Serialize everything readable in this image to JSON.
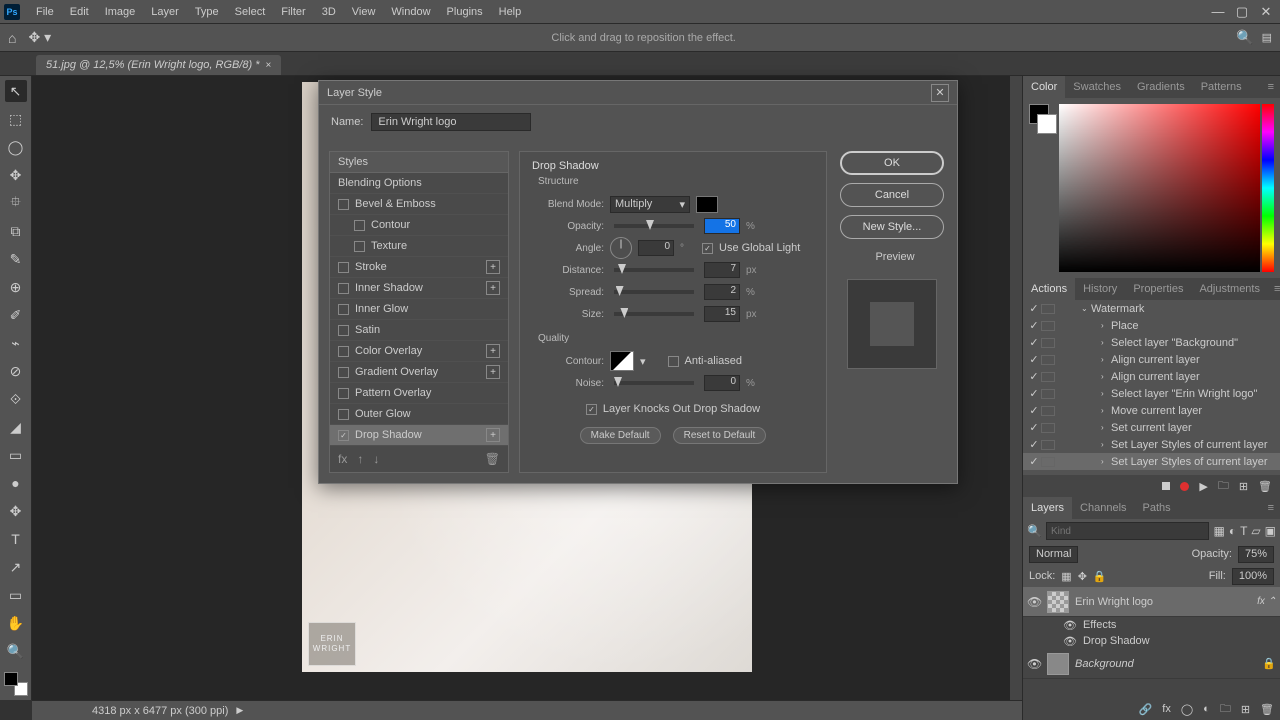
{
  "menu": [
    "File",
    "Edit",
    "Image",
    "Layer",
    "Type",
    "Select",
    "Filter",
    "3D",
    "View",
    "Window",
    "Plugins",
    "Help"
  ],
  "optbar_hint": "Click and drag to reposition the effect.",
  "doc_tab": "51.jpg @ 12,5% (Erin Wright logo, RGB/8) *",
  "status": "4318 px x 6477 px (300 ppi)",
  "logo_text": "ERIN\nWRIGHT",
  "tools": [
    "↖",
    "⬚",
    "◯",
    "✥",
    "⯐",
    "⧉",
    "✎",
    "⊕",
    "✐",
    "⌁",
    "⊘",
    "⟐",
    "◢",
    "▭",
    "●",
    "✥",
    "◔",
    "✏",
    "T",
    "↗",
    "▭",
    "✋",
    "🔍"
  ],
  "color_tabs": [
    "Color",
    "Swatches",
    "Gradients",
    "Patterns"
  ],
  "mid_tabs": [
    "Actions",
    "History",
    "Properties",
    "Adjustments"
  ],
  "actions": [
    {
      "label": "Watermark",
      "indent": 20,
      "chev": "⌄"
    },
    {
      "label": "Place",
      "indent": 40,
      "chev": "›"
    },
    {
      "label": "Select layer \"Background\"",
      "indent": 40,
      "chev": "›"
    },
    {
      "label": "Align current layer",
      "indent": 40,
      "chev": "›"
    },
    {
      "label": "Align current layer",
      "indent": 40,
      "chev": "›"
    },
    {
      "label": "Select layer \"Erin Wright logo\"",
      "indent": 40,
      "chev": "›"
    },
    {
      "label": "Move current layer",
      "indent": 40,
      "chev": "›"
    },
    {
      "label": "Set current layer",
      "indent": 40,
      "chev": "›"
    },
    {
      "label": "Set Layer Styles of current layer",
      "indent": 40,
      "chev": "›"
    },
    {
      "label": "Set Layer Styles of current layer",
      "indent": 40,
      "chev": "›",
      "hi": true
    }
  ],
  "layer_tabs": [
    "Layers",
    "Channels",
    "Paths"
  ],
  "layers_kind": "Kind",
  "layers_mode": "Normal",
  "layers_opacity_label": "Opacity:",
  "layers_opacity": "75%",
  "layers_lock": "Lock:",
  "layers_fill_label": "Fill:",
  "layers_fill": "100%",
  "layer_items": [
    {
      "name": "Erin Wright logo",
      "fx": true,
      "sel": true,
      "check": true
    },
    {
      "name": "Background",
      "fx": false,
      "sel": false,
      "check": false
    }
  ],
  "layer_fx_sub": [
    "Effects",
    "Drop Shadow"
  ],
  "dialog": {
    "title": "Layer Style",
    "name_label": "Name:",
    "name_value": "Erin Wright logo",
    "styles_head": "Styles",
    "blending": "Blending Options",
    "fx": [
      {
        "label": "Bevel & Emboss",
        "on": false,
        "plus": false
      },
      {
        "label": "Contour",
        "on": false,
        "plus": false,
        "indent": true
      },
      {
        "label": "Texture",
        "on": false,
        "plus": false,
        "indent": true
      },
      {
        "label": "Stroke",
        "on": false,
        "plus": true
      },
      {
        "label": "Inner Shadow",
        "on": false,
        "plus": true
      },
      {
        "label": "Inner Glow",
        "on": false,
        "plus": false
      },
      {
        "label": "Satin",
        "on": false,
        "plus": false
      },
      {
        "label": "Color Overlay",
        "on": false,
        "plus": true
      },
      {
        "label": "Gradient Overlay",
        "on": false,
        "plus": true
      },
      {
        "label": "Pattern Overlay",
        "on": false,
        "plus": false
      },
      {
        "label": "Outer Glow",
        "on": false,
        "plus": false
      },
      {
        "label": "Drop Shadow",
        "on": true,
        "plus": true,
        "sel": true
      }
    ],
    "section": "Drop Shadow",
    "structure": "Structure",
    "blend_mode_label": "Blend Mode:",
    "blend_mode": "Multiply",
    "opacity_label": "Opacity:",
    "opacity": "50",
    "angle_label": "Angle:",
    "angle": "0",
    "global_light": "Use Global Light",
    "distance_label": "Distance:",
    "distance": "7",
    "spread_label": "Spread:",
    "spread": "2",
    "size_label": "Size:",
    "size": "15",
    "quality": "Quality",
    "contour_label": "Contour:",
    "antialias": "Anti-aliased",
    "noise_label": "Noise:",
    "noise": "0",
    "knockout": "Layer Knocks Out Drop Shadow",
    "make_default": "Make Default",
    "reset_default": "Reset to Default",
    "ok": "OK",
    "cancel": "Cancel",
    "new_style": "New Style...",
    "preview": "Preview"
  }
}
